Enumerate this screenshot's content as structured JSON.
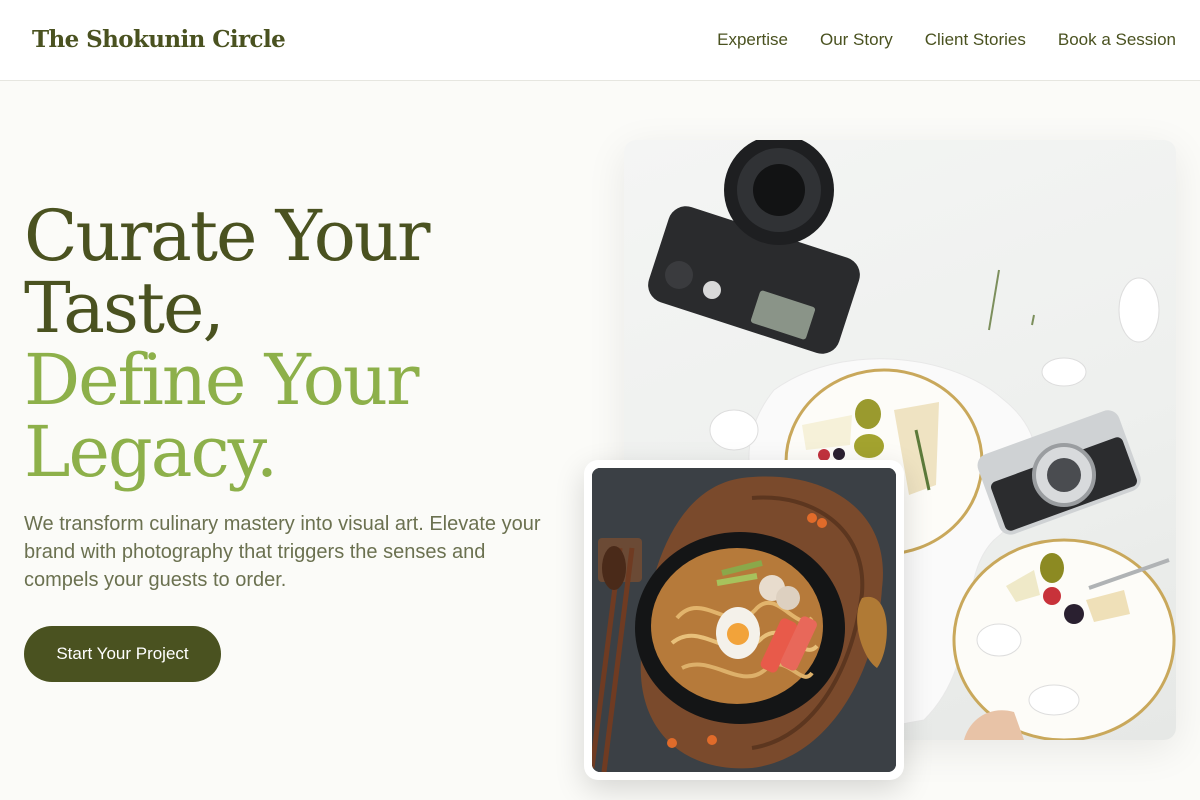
{
  "header": {
    "logo": "The Shokunin Circle",
    "nav": [
      "Expertise",
      "Our Story",
      "Client Stories",
      "Book a Session"
    ]
  },
  "hero": {
    "title_line1": "Curate Your",
    "title_line2": "Taste,",
    "title_line3": "Define Your",
    "title_line4": "Legacy.",
    "subtitle": "We transform culinary mastery into visual art. Elevate your brand with photography that triggers the senses and compels your guests to order.",
    "cta_label": "Start Your Project"
  },
  "colors": {
    "brand_dark": "#4a5220",
    "brand_light": "#8db04a",
    "background": "#fbfbf8"
  }
}
